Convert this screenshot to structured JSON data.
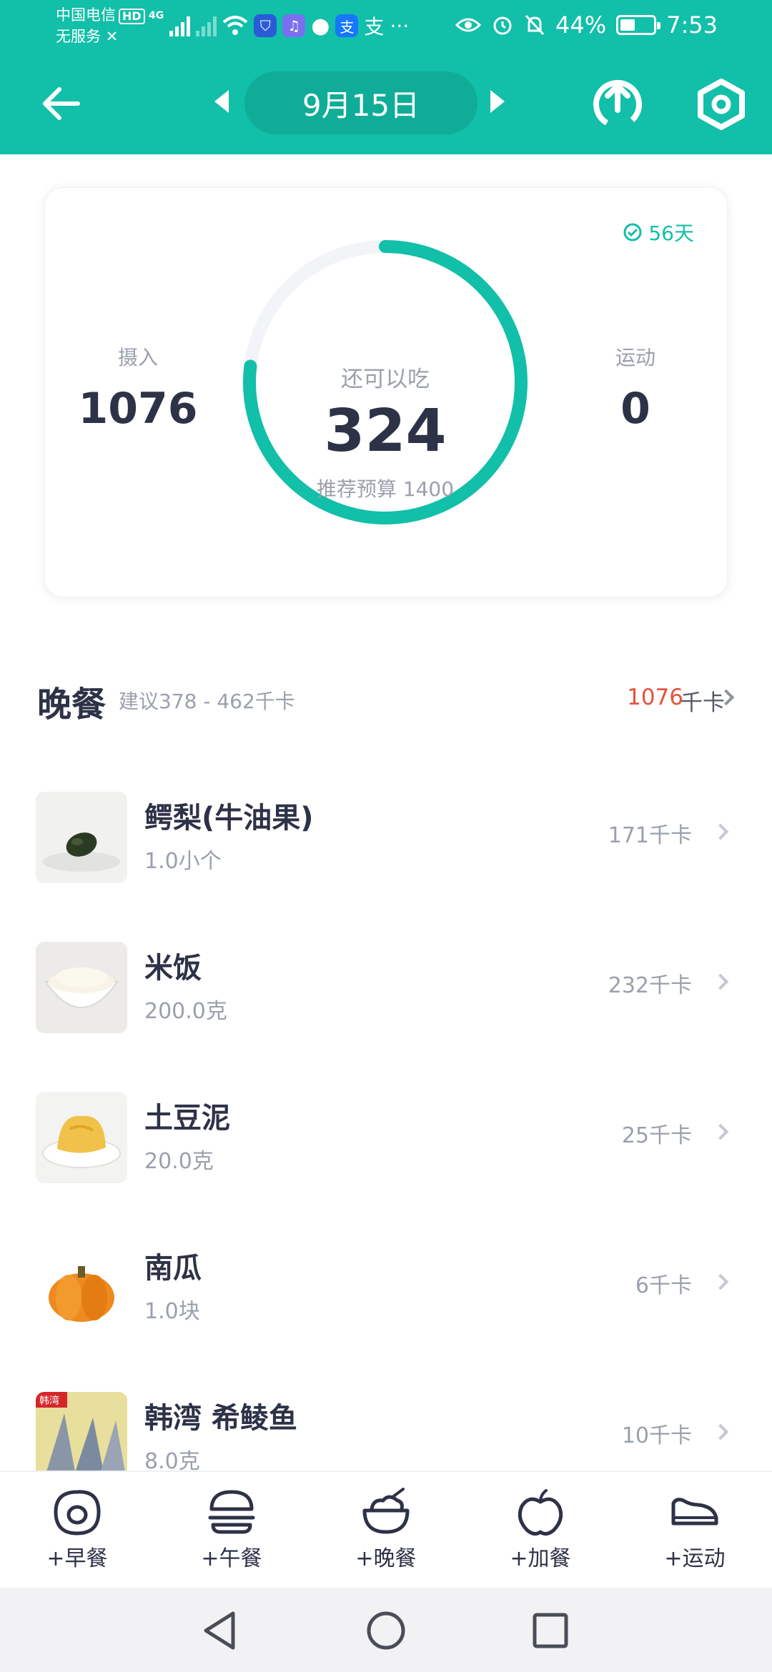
{
  "status_bar": {
    "carrier_line1": "中国电信",
    "carrier_hd": "HD",
    "carrier_line2": "无服务",
    "net_label": "4G",
    "battery_percent": "44%",
    "battery_level": 0.44,
    "time": "7:53"
  },
  "header": {
    "date": "9月15日"
  },
  "summary": {
    "streak": "56天",
    "intake_label": "摄入",
    "intake_value": "1076",
    "remaining_label": "还可以吃",
    "remaining_value": "324",
    "budget_text": "推荐预算 1400",
    "exercise_label": "运动",
    "exercise_value": "0",
    "ring_progress": 0.7686
  },
  "meal": {
    "title": "晚餐",
    "recommendation": "建议378 - 462千卡",
    "total": "1076",
    "unit": "千卡"
  },
  "foods": [
    {
      "name": "鳄梨(牛油果)",
      "quantity": "1.0小个",
      "kcal": "171千卡"
    },
    {
      "name": "米饭",
      "quantity": "200.0克",
      "kcal": "232千卡"
    },
    {
      "name": "土豆泥",
      "quantity": "20.0克",
      "kcal": "25千卡"
    },
    {
      "name": "南瓜",
      "quantity": "1.0块",
      "kcal": "6千卡"
    },
    {
      "name": "韩湾 希鲮鱼",
      "quantity": "8.0克",
      "kcal": "10千卡",
      "thumb_text": "韩湾"
    }
  ],
  "actions": [
    {
      "label": "+早餐",
      "icon": "egg-icon"
    },
    {
      "label": "+午餐",
      "icon": "burger-icon"
    },
    {
      "label": "+晚餐",
      "icon": "rice-bowl-icon"
    },
    {
      "label": "+加餐",
      "icon": "apple-icon"
    },
    {
      "label": "+运动",
      "icon": "sneaker-icon"
    }
  ],
  "colors": {
    "brand": "#12bfa9",
    "over_budget": "#e5533d",
    "text_primary": "#2e3247",
    "text_secondary": "#9aa0ac"
  }
}
